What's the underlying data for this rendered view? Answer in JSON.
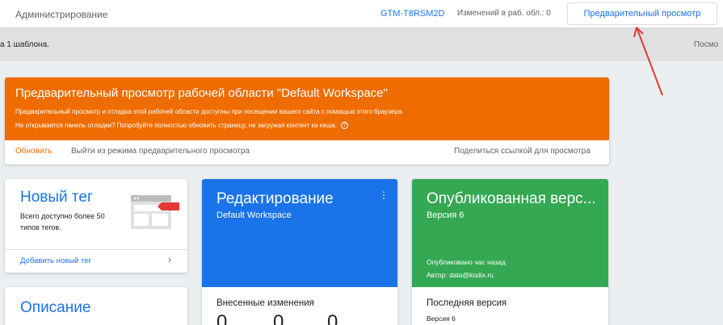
{
  "header": {
    "admin": "Администрирование",
    "container_id": "GTM-T8RSM2D",
    "workspace_changes": "Изменений в раб. обл.: 0",
    "preview_button": "Предварительный просмотр"
  },
  "subbar": {
    "left_text": "а 1 шаблона.",
    "right_text": "Посмо"
  },
  "preview_banner": {
    "title": "Предварительный просмотр рабочей области \"Default Workspace\"",
    "line1": "Предварительный просмотр и отладка этой рабочей области доступны при посещении вашего сайта с помощью этого браузера.",
    "line2": "Не открывается панель отладки? Попробуйте полностью обновить страницу, не загружая контент из кеша.",
    "help_glyph": "?",
    "update": "Обновить",
    "exit": "Выйти из режима предварительного просмотра",
    "share": "Поделиться ссылкой для просмотра",
    "color": "#ef6c00"
  },
  "new_tag": {
    "title": "Новый тег",
    "desc": "Всего доступно более 50 типов тегов.",
    "add_link": "Добавить новый тег",
    "chevron": "›"
  },
  "description": {
    "title": "Описание"
  },
  "edit": {
    "title": "Редактирование",
    "subtitle": "Default Workspace",
    "kebab": "⋮",
    "changes_title": "Внесенные изменения",
    "counts": [
      "0",
      "0",
      "0"
    ],
    "color": "#1a73e8"
  },
  "published": {
    "title": "Опубликованная верс...",
    "subtitle": "Версия 6",
    "published_time": "Опубликовано час назад",
    "author": "Автор: data@kodix.ru",
    "latest_title": "Последняя версия",
    "latest_sub": "Версия 6",
    "color": "#34a853"
  }
}
